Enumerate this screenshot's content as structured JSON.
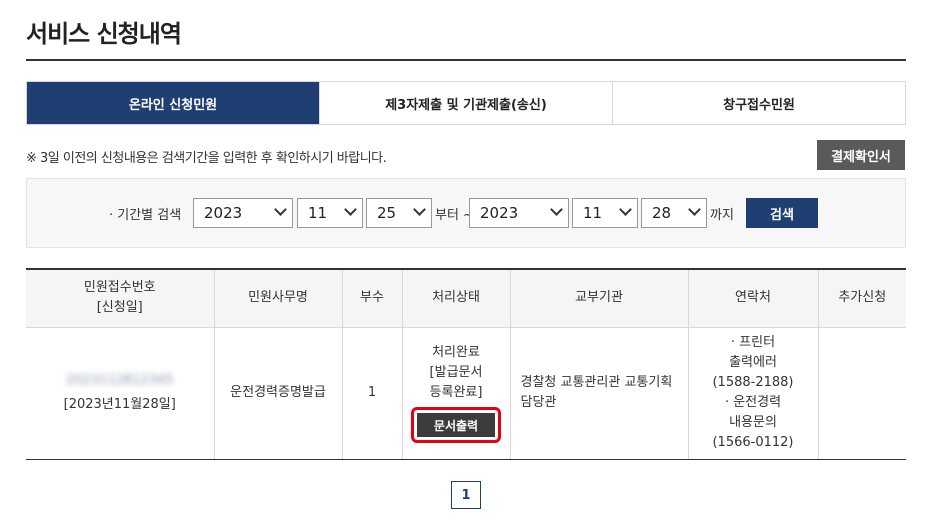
{
  "page": {
    "title": "서비스 신청내역"
  },
  "tabs": [
    {
      "label": "온라인 신청민원",
      "active": true
    },
    {
      "label": "제3자제출 및 기관제출(송신)",
      "active": false
    },
    {
      "label": "창구접수민원",
      "active": false
    }
  ],
  "notice": "※ 3일 이전의 신청내용은 검색기간을 입력한 후 확인하시기 바랍니다.",
  "buttons": {
    "receipt": "결제확인서",
    "search": "검색",
    "print": "문서출력"
  },
  "search": {
    "label": "· 기간별 검색",
    "from": {
      "year": "2023",
      "month": "11",
      "day": "25"
    },
    "from_suffix": "부터 ~",
    "to": {
      "year": "2023",
      "month": "11",
      "day": "28"
    },
    "to_suffix": "까지"
  },
  "table": {
    "headers": {
      "receipt_no": "민원접수번호",
      "receipt_date": "[신청일]",
      "service": "민원사무명",
      "copies": "부수",
      "status": "처리상태",
      "agency": "교부기관",
      "contact": "연락처",
      "extra": "추가신청"
    },
    "rows": [
      {
        "receipt_no": "2023112812345",
        "date": "[2023년11월28일]",
        "service": "운전경력증명발급",
        "copies": "1",
        "status_lines": [
          "처리완료",
          "[발급문서",
          "등록완료]"
        ],
        "agency": "경찰청 교통관리관 교통기획담당관",
        "contact_lines": [
          "· 프린터",
          "출력에러",
          "(1588-2188)",
          "· 운전경력",
          "내용문의",
          "(1566-0112)"
        ],
        "extra": ""
      }
    ]
  },
  "pagination": {
    "current": "1"
  },
  "colors": {
    "primary": "#1f3f73",
    "highlight": "#e60012",
    "dark_button": "#5a5a5a"
  }
}
